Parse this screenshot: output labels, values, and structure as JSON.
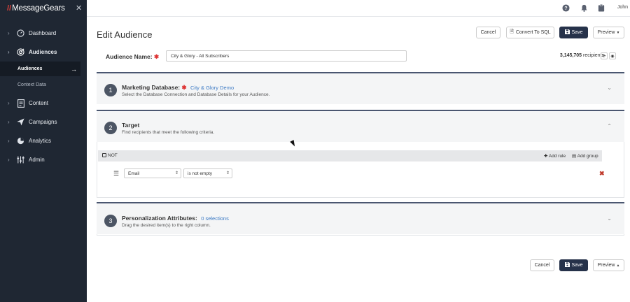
{
  "app": {
    "logo_mark": "//",
    "logo_text": "MessageGears"
  },
  "sidebar": {
    "items": [
      {
        "label": "Dashboard"
      },
      {
        "label": "Audiences"
      },
      {
        "label": "Content"
      },
      {
        "label": "Campaigns"
      },
      {
        "label": "Analytics"
      },
      {
        "label": "Admin"
      }
    ],
    "subitems": [
      {
        "label": "Audiences"
      },
      {
        "label": "Context Data"
      }
    ]
  },
  "topbar": {
    "user": "John"
  },
  "page": {
    "title": "Edit Audience",
    "cancel": "Cancel",
    "convert_sql": "Convert To SQL",
    "save": "Save",
    "preview": "Preview"
  },
  "audience": {
    "name_label": "Audience Name:",
    "name_value": "City & Glory - All Subscribers",
    "recipient_count": "3,145,705",
    "recipients_label": "recipients"
  },
  "sections": [
    {
      "num": "1",
      "title": "Marketing Database:",
      "link": "City & Glory Demo",
      "sub": "Select the Database Connection and Database Details for your Audience."
    },
    {
      "num": "2",
      "title": "Target",
      "link": "",
      "sub": "Find recipients that meet the following criteria."
    },
    {
      "num": "3",
      "title": "Personalization Attributes:",
      "link": "0 selections",
      "sub": "Drag the desired item(s) to the right column."
    }
  ],
  "target": {
    "not_label": "NOT",
    "add_rule": "Add rule",
    "add_group": "Add group",
    "field": "Email",
    "operator": "is not empty"
  },
  "footer": {
    "cancel": "Cancel",
    "save": "Save",
    "preview": "Preview"
  },
  "colors": {
    "sidebar_bg": "#1f2733",
    "primary": "#26324a",
    "link": "#3b79c4",
    "required": "#d33333"
  }
}
